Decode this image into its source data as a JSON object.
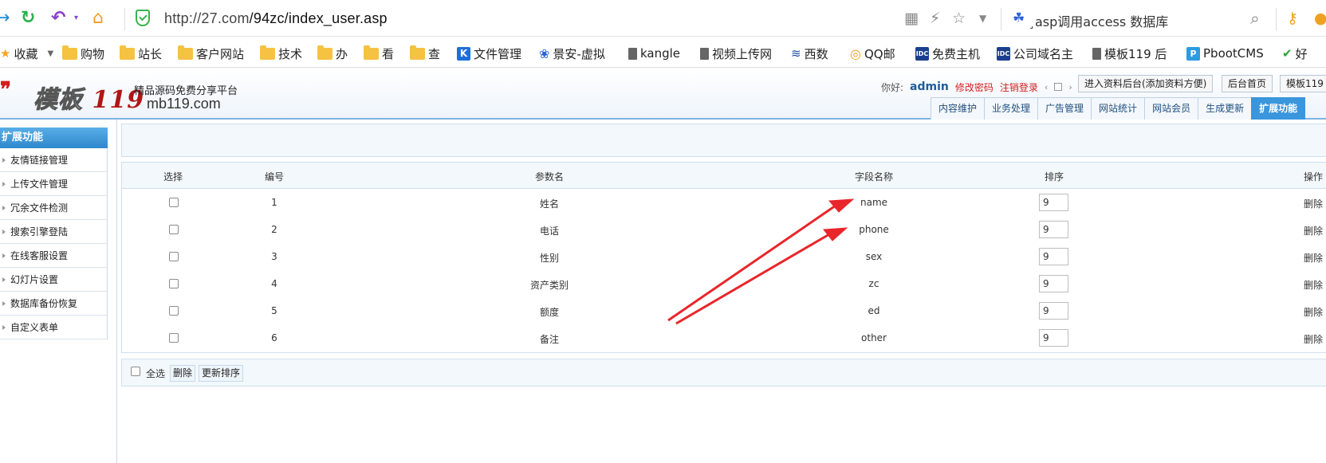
{
  "browser": {
    "url_host": "http://27.com",
    "url_path": "/94zc/index_user.asp",
    "search_text": "asp调用access 数据库",
    "search_prefix": "¸"
  },
  "bookmarks": [
    {
      "label": "收藏",
      "icon": "star-icon"
    },
    {
      "label": "购物",
      "icon": "folder-icon"
    },
    {
      "label": "站长",
      "icon": "folder-icon"
    },
    {
      "label": "客户网站",
      "icon": "folder-icon"
    },
    {
      "label": "技术",
      "icon": "folder-icon"
    },
    {
      "label": "办",
      "icon": "folder-icon"
    },
    {
      "label": "看",
      "icon": "folder-icon"
    },
    {
      "label": "查",
      "icon": "folder-icon"
    },
    {
      "label": "文件管理",
      "icon": "k-icon"
    },
    {
      "label": "景安-虚拟",
      "icon": "bird-icon"
    },
    {
      "label": "kangle",
      "icon": "page-icon"
    },
    {
      "label": "视频上传网",
      "icon": "page-icon"
    },
    {
      "label": "西数",
      "icon": "wave-icon"
    },
    {
      "label": "QQ邮",
      "icon": "qq-icon"
    },
    {
      "label": "免费主机",
      "icon": "idc-icon"
    },
    {
      "label": "公司域名主",
      "icon": "idc-icon"
    },
    {
      "label": "模板119 后",
      "icon": "page-icon"
    },
    {
      "label": "PbootCMS",
      "icon": "p-icon"
    },
    {
      "label": "好",
      "icon": "hao-icon"
    }
  ],
  "site": {
    "logo_cn": "模板",
    "logo_num": "119",
    "slogan": "精品源码免费分享平台",
    "domain": "mb119.com",
    "greeting": "你好:",
    "username": "admin",
    "change_password": "修改密码",
    "logout": "注销登录",
    "buttons": [
      "进入资料后台(添加资料方便)",
      "后台首页",
      "模板119"
    ],
    "tabs": [
      "内容维护",
      "业务处理",
      "广告管理",
      "网站统计",
      "网站会员",
      "生成更新",
      "扩展功能"
    ],
    "active_tab": 6
  },
  "sidebar": {
    "title": "扩展功能",
    "items": [
      "友情链接管理",
      "上传文件管理",
      "冗余文件检测",
      "搜索引擎登陆",
      "在线客服设置",
      "幻灯片设置",
      "数据库备份恢复",
      "自定义表单"
    ]
  },
  "table": {
    "headers": [
      "选择",
      "编号",
      "参数名",
      "字段名称",
      "排序",
      "操作"
    ],
    "rows": [
      {
        "id": "1",
        "param": "姓名",
        "field": "name",
        "sort": "9",
        "action": "删除"
      },
      {
        "id": "2",
        "param": "电话",
        "field": "phone",
        "sort": "9",
        "action": "删除"
      },
      {
        "id": "3",
        "param": "性别",
        "field": "sex",
        "sort": "9",
        "action": "删除"
      },
      {
        "id": "4",
        "param": "资产类别",
        "field": "zc",
        "sort": "9",
        "action": "删除"
      },
      {
        "id": "5",
        "param": "额度",
        "field": "ed",
        "sort": "9",
        "action": "删除"
      },
      {
        "id": "6",
        "param": "备注",
        "field": "other",
        "sort": "9",
        "action": "删除"
      }
    ]
  },
  "footer": {
    "select_all": "全选",
    "delete": "删除",
    "update_sort": "更新排序"
  },
  "colors": {
    "accent": "#3a96dd",
    "annotation_arrow": "#e8262b"
  }
}
